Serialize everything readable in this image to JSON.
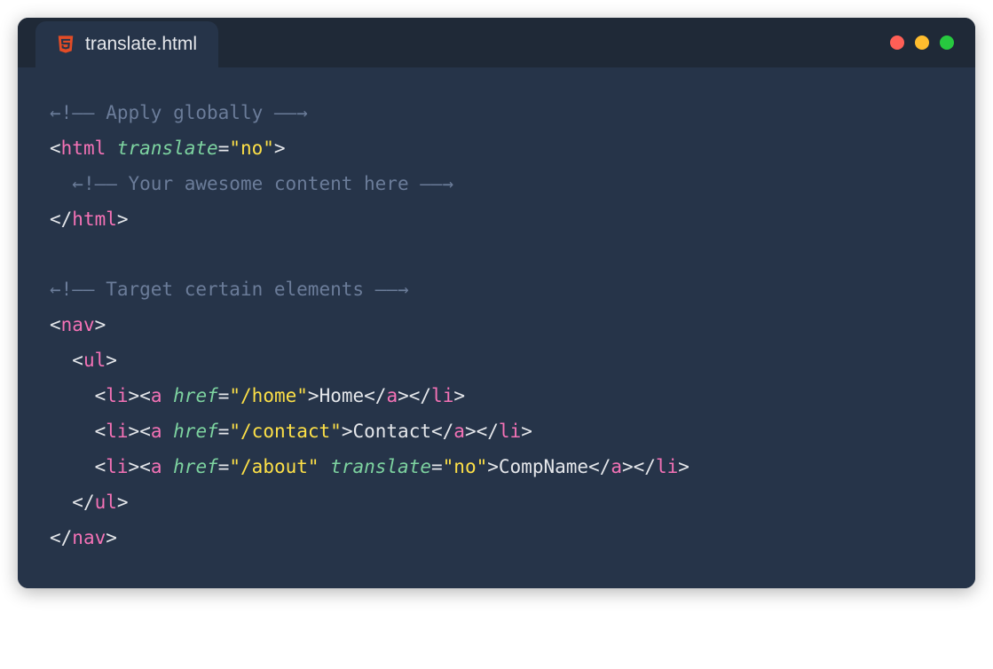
{
  "tab": {
    "filename": "translate.html",
    "icon": "html5-icon"
  },
  "window_controls": {
    "close": "red",
    "minimize": "yellow",
    "maximize": "green"
  },
  "code": {
    "line1": {
      "comment_open": "←!——",
      "comment_text": " Apply globally ",
      "comment_close": "——→"
    },
    "line2": {
      "bracket_open": "<",
      "tag": "html",
      "attr": "translate",
      "equals": "=",
      "string": "\"no\"",
      "bracket_close": ">"
    },
    "line3": {
      "indent": "  ",
      "comment_open": "←!——",
      "comment_text": " Your awesome content here ",
      "comment_close": "——→"
    },
    "line4": {
      "bracket_open": "</",
      "tag": "html",
      "bracket_close": ">"
    },
    "line6": {
      "comment_open": "←!——",
      "comment_text": " Target certain elements ",
      "comment_close": "——→"
    },
    "line7": {
      "bracket_open": "<",
      "tag": "nav",
      "bracket_close": ">"
    },
    "line8": {
      "indent": "  ",
      "bracket_open": "<",
      "tag": "ul",
      "bracket_close": ">"
    },
    "line9": {
      "indent": "    ",
      "li_open_bracket": "<",
      "li_tag": "li",
      "li_open_close": ">",
      "a_open_bracket": "<",
      "a_tag": "a",
      "href_attr": "href",
      "href_equals": "=",
      "href_value": "\"/home\"",
      "a_open_close": ">",
      "link_text": "Home",
      "a_close_bracket": "</",
      "a_close_tag": "a",
      "a_close_close": ">",
      "li_close_bracket": "</",
      "li_close_tag": "li",
      "li_close_close": ">"
    },
    "line10": {
      "indent": "    ",
      "li_open_bracket": "<",
      "li_tag": "li",
      "li_open_close": ">",
      "a_open_bracket": "<",
      "a_tag": "a",
      "href_attr": "href",
      "href_equals": "=",
      "href_value": "\"/contact\"",
      "a_open_close": ">",
      "link_text": "Contact",
      "a_close_bracket": "</",
      "a_close_tag": "a",
      "a_close_close": ">",
      "li_close_bracket": "</",
      "li_close_tag": "li",
      "li_close_close": ">"
    },
    "line11": {
      "indent": "    ",
      "li_open_bracket": "<",
      "li_tag": "li",
      "li_open_close": ">",
      "a_open_bracket": "<",
      "a_tag": "a",
      "href_attr": "href",
      "href_equals": "=",
      "href_value": "\"/about\"",
      "translate_attr": "translate",
      "translate_equals": "=",
      "translate_value": "\"no\"",
      "a_open_close": ">",
      "link_text": "CompName",
      "a_close_bracket": "</",
      "a_close_tag": "a",
      "a_close_close": ">",
      "li_close_bracket": "</",
      "li_close_tag": "li",
      "li_close_close": ">"
    },
    "line12": {
      "indent": "  ",
      "bracket_open": "</",
      "tag": "ul",
      "bracket_close": ">"
    },
    "line13": {
      "bracket_open": "</",
      "tag": "nav",
      "bracket_close": ">"
    }
  }
}
